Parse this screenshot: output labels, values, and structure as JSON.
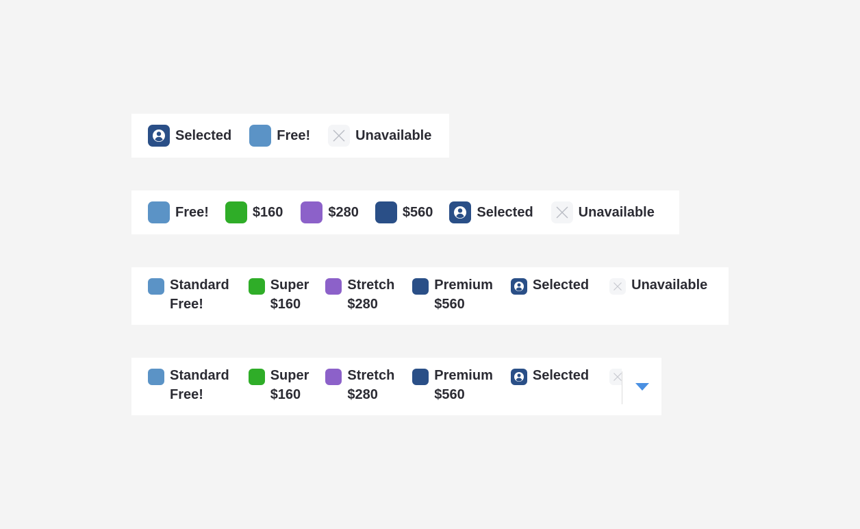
{
  "colors": {
    "free": "#5b93c6",
    "super": "#2fad28",
    "stretch": "#8c61c9",
    "premium": "#2a4f87",
    "selected": "#2a4f87",
    "unavailable_bg": "#f4f5f7",
    "unavailable_x": "#b9bcc4",
    "dropdown": "#4a90e2"
  },
  "legend1": {
    "selected": "Selected",
    "free": "Free!",
    "unavailable": "Unavailable"
  },
  "legend2": {
    "free": "Free!",
    "p160": "$160",
    "p280": "$280",
    "p560": "$560",
    "selected": "Selected",
    "unavailable": "Unavailable"
  },
  "legend3": {
    "standard": "Standard",
    "standard_price": "Free!",
    "super": "Super",
    "super_price": "$160",
    "stretch": "Stretch",
    "stretch_price": "$280",
    "premium": "Premium",
    "premium_price": "$560",
    "selected": "Selected",
    "unavailable": "Unavailable"
  },
  "legend4": {
    "standard": "Standard",
    "standard_price": "Free!",
    "super": "Super",
    "super_price": "$160",
    "stretch": "Stretch",
    "stretch_price": "$280",
    "premium": "Premium",
    "premium_price": "$560",
    "selected": "Selected",
    "dropdown_icon": "caret-down-icon"
  }
}
